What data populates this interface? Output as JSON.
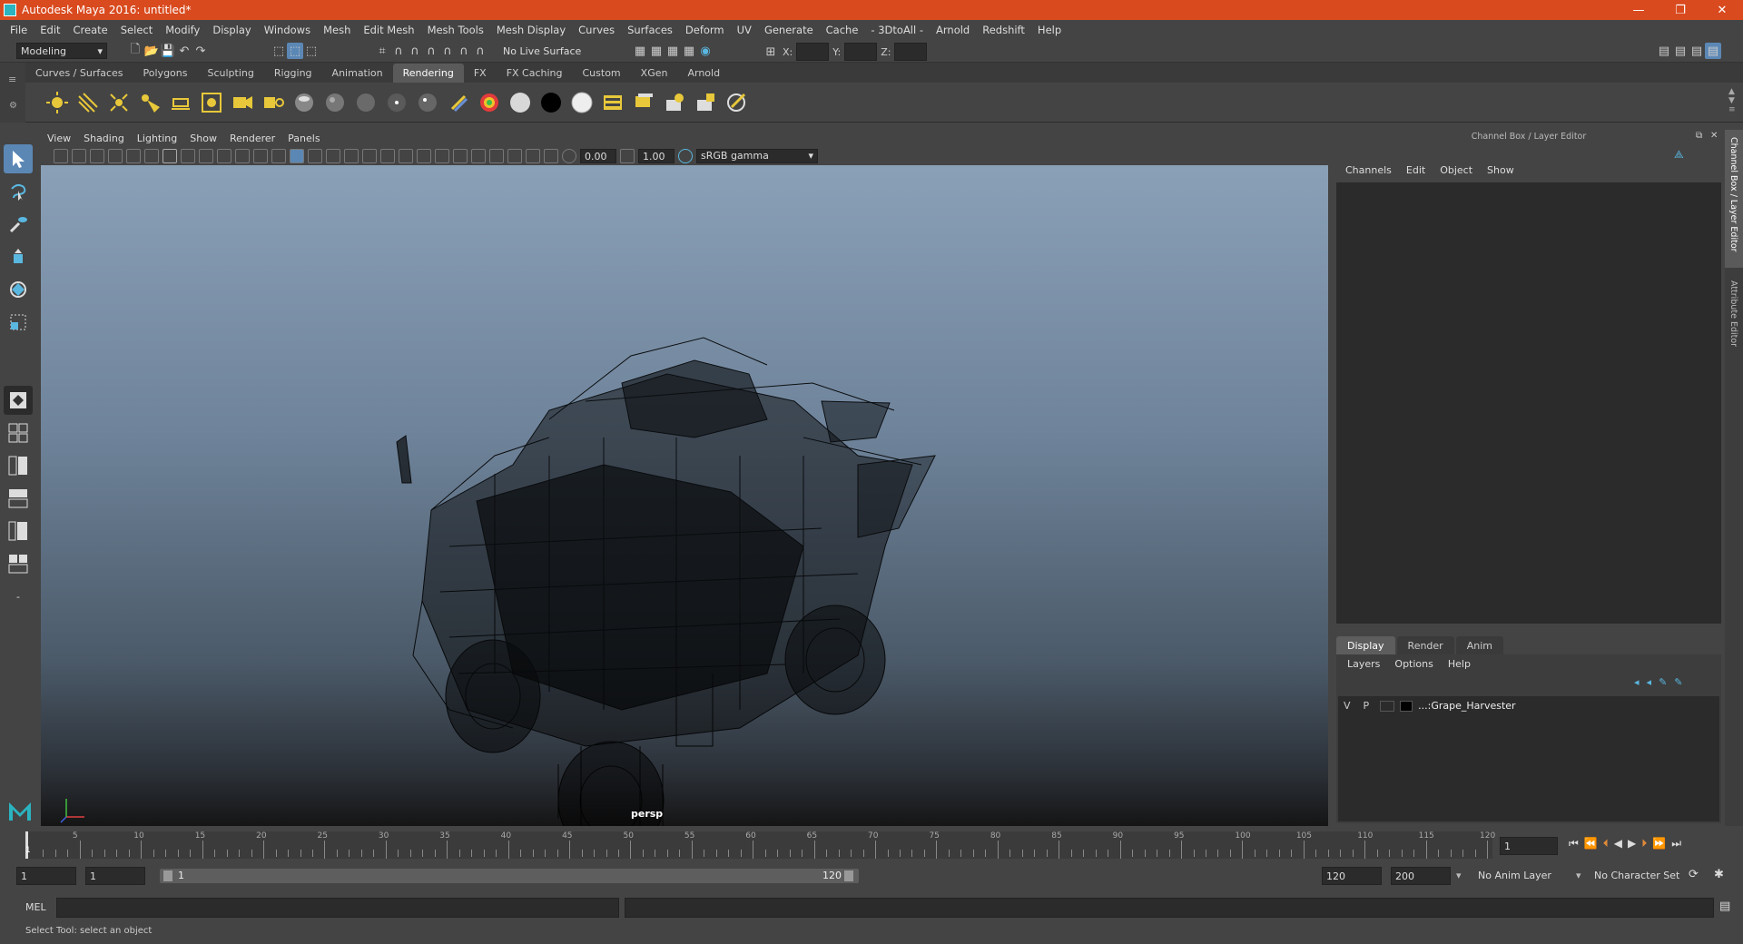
{
  "window": {
    "title": "Autodesk Maya 2016: untitled*",
    "minimize": "—",
    "maximize": "❐",
    "close": "✕"
  },
  "menubar": [
    "File",
    "Edit",
    "Create",
    "Select",
    "Modify",
    "Display",
    "Windows",
    "Mesh",
    "Edit Mesh",
    "Mesh Tools",
    "Mesh Display",
    "Curves",
    "Surfaces",
    "Deform",
    "UV",
    "Generate",
    "Cache",
    "- 3DtoAll -",
    "Arnold",
    "Redshift",
    "Help"
  ],
  "statusline": {
    "mode": "Modeling",
    "live_surface": "No Live Surface",
    "x_label": "X:",
    "y_label": "Y:",
    "z_label": "Z:"
  },
  "shelf_tabs": [
    "Curves / Surfaces",
    "Polygons",
    "Sculpting",
    "Rigging",
    "Animation",
    "Rendering",
    "FX",
    "FX Caching",
    "Custom",
    "XGen",
    "Arnold"
  ],
  "active_shelf_tab": "Rendering",
  "viewport": {
    "menus": [
      "View",
      "Shading",
      "Lighting",
      "Show",
      "Renderer",
      "Panels"
    ],
    "exposure": "0.00",
    "gamma": "1.00",
    "color_space": "sRGB gamma",
    "camera_label": "persp"
  },
  "channel_box": {
    "title": "Channel Box / Layer Editor",
    "menus": [
      "Channels",
      "Edit",
      "Object",
      "Show"
    ]
  },
  "layer_editor": {
    "tabs": [
      "Display",
      "Render",
      "Anim"
    ],
    "active_tab": "Display",
    "menus": [
      "Layers",
      "Options",
      "Help"
    ],
    "layer": {
      "v": "V",
      "p": "P",
      "name": "...:Grape_Harvester"
    }
  },
  "side_tabs": {
    "channel_box": "Channel Box / Layer Editor",
    "attribute_editor": "Attribute Editor"
  },
  "timeline": {
    "ticks": [
      "5",
      "10",
      "15",
      "20",
      "25",
      "30",
      "35",
      "40",
      "45",
      "50",
      "55",
      "60",
      "65",
      "70",
      "75",
      "80",
      "85",
      "90",
      "95",
      "100",
      "105",
      "110",
      "115",
      "120"
    ],
    "current_frame_marker": "1",
    "current_frame": "1"
  },
  "range": {
    "start": "1",
    "playback_start": "1",
    "slider_start": "1",
    "slider_end": "120",
    "playback_end": "120",
    "end": "200",
    "anim_layer": "No Anim Layer",
    "character_set": "No Character Set"
  },
  "command": {
    "language": "MEL"
  },
  "help_line": "Select Tool: select an object"
}
